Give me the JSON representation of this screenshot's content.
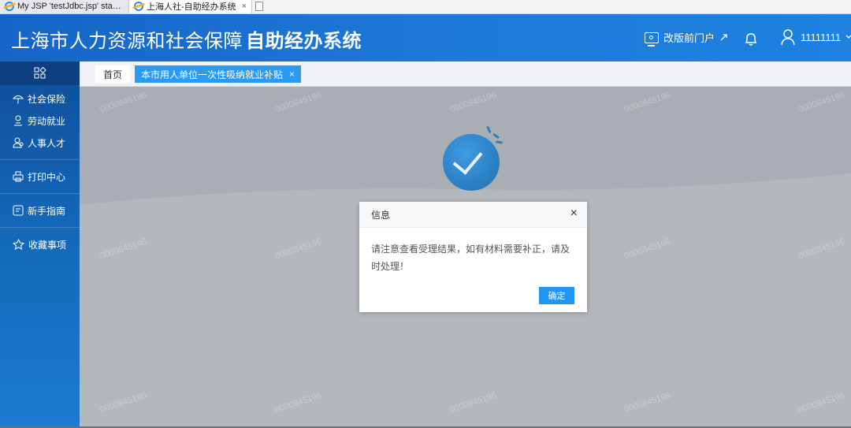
{
  "browser": {
    "tabs": [
      {
        "title": "My JSP 'testJdbc.jsp' startin...",
        "active": false
      },
      {
        "title": "上海人社-自助经办系统",
        "active": true
      }
    ],
    "close_glyph": "×"
  },
  "header": {
    "title_light": "上海市人力资源和社会保障",
    "title_bold": "自助经办系统",
    "portal_link": "改版前门户",
    "username": "11111111"
  },
  "sidebar": {
    "items": [
      {
        "label": "社会保险",
        "icon": "umbrella-icon"
      },
      {
        "label": "劳动就业",
        "icon": "worker-icon"
      },
      {
        "label": "人事人才",
        "icon": "people-icon"
      },
      {
        "label": "打印中心",
        "icon": "printer-icon"
      },
      {
        "label": "新手指南",
        "icon": "guide-icon"
      },
      {
        "label": "收藏事项",
        "icon": "star-icon"
      }
    ]
  },
  "tabs": {
    "home": "首页",
    "current": "本市用人单位一次性吸纳就业补贴",
    "close_glyph": "×"
  },
  "content": {
    "watermark": "0000845196"
  },
  "dialog": {
    "title": "信息",
    "message": "请注意查看受理结果，如有材料需要补正，请及时处理！",
    "confirm": "确定",
    "close_glyph": "×"
  },
  "colors": {
    "header": "#1e7ad9",
    "accent": "#2196f3",
    "sidebar": "#1467b8"
  }
}
